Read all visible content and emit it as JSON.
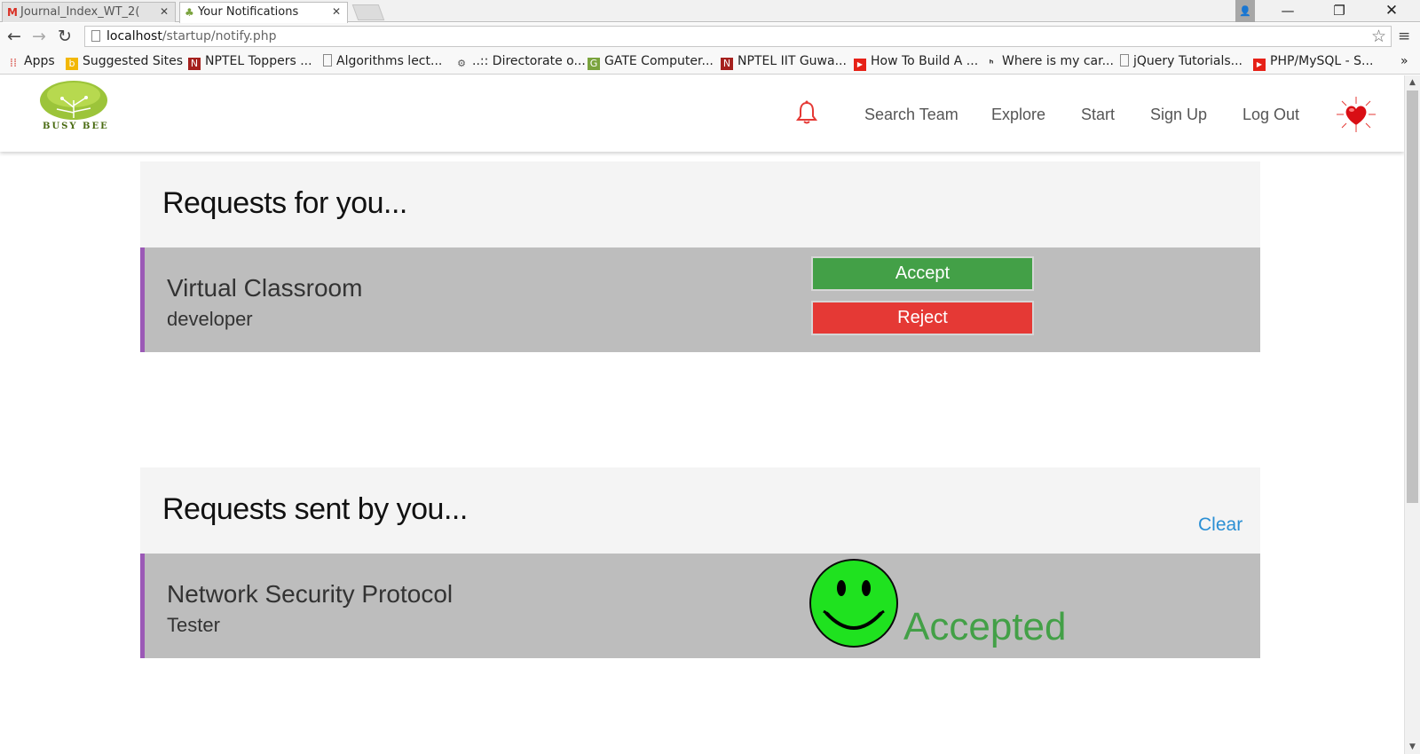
{
  "browser": {
    "tabs": [
      {
        "title": "Journal_Index_WT_2(",
        "icon": "gmail-icon",
        "active": false
      },
      {
        "title": "Your Notifications",
        "icon": "tree-favicon",
        "active": true
      }
    ],
    "url_host": "localhost",
    "url_path": "/startup/notify.php",
    "bookmarks": [
      {
        "label": "Apps",
        "icon": "apps-grid-icon",
        "color": "#d8524a"
      },
      {
        "label": "Suggested Sites",
        "icon": "bing-icon",
        "color": "#f2b705"
      },
      {
        "label": "NPTEL Toppers ...",
        "icon": "nptel-icon",
        "color": "#a5201d"
      },
      {
        "label": "Algorithms lect...",
        "icon": "page-icon",
        "color": "#ffffff"
      },
      {
        "label": "..:: Directorate o...",
        "icon": "gear-seal-icon",
        "color": "#777777"
      },
      {
        "label": "GATE Computer...",
        "icon": "gate-icon",
        "color": "#7aa33d"
      },
      {
        "label": "NPTEL IIT Guwa...",
        "icon": "nptel-icon",
        "color": "#a5201d"
      },
      {
        "label": "How To Build A ...",
        "icon": "youtube-icon",
        "color": "#e62117"
      },
      {
        "label": "Where is my car...",
        "icon": "codechef-icon",
        "color": "#333333"
      },
      {
        "label": "jQuery Tutorials...",
        "icon": "page-icon",
        "color": "#ffffff"
      },
      {
        "label": "PHP/MySQL - S...",
        "icon": "youtube-icon",
        "color": "#e62117"
      }
    ]
  },
  "site": {
    "logo_text": "BUSY BEE",
    "nav": [
      "Search Team",
      "Explore",
      "Start",
      "Sign Up",
      "Log Out"
    ],
    "accent": "#43a047",
    "danger": "#e53935",
    "link": "#2a8fd4",
    "card_border": "#9b59b6"
  },
  "received": {
    "title": "Requests for you...",
    "items": [
      {
        "project": "Virtual Classroom",
        "role": "developer",
        "accept_label": "Accept",
        "reject_label": "Reject"
      }
    ]
  },
  "sent": {
    "title": "Requests sent by you...",
    "clear_label": "Clear",
    "items": [
      {
        "project": "Network Security Protocol",
        "role": "Tester",
        "status": "Accepted"
      }
    ]
  }
}
